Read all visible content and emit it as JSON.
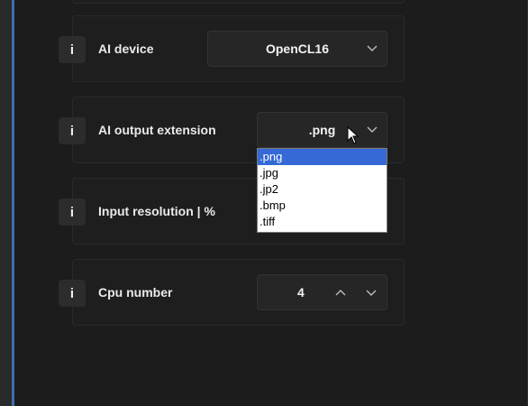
{
  "settings": [
    {
      "label": "AI device",
      "value": "OpenCL16",
      "info": "i"
    },
    {
      "label": "AI output extension",
      "value": ".png",
      "info": "i"
    },
    {
      "label": "Input resolution | %",
      "info": "i"
    },
    {
      "label": "Cpu number",
      "value": "4",
      "info": "i"
    }
  ],
  "dropdown": {
    "options": [
      ".png",
      ".jpg",
      ".jp2",
      ".bmp",
      ".tiff"
    ],
    "selected_index": 0
  },
  "colors": {
    "background": "#1c1c1c",
    "card": "#1e1e1e",
    "selection": "#3469d6",
    "accent_edge": "#3d6fae"
  },
  "icons": {
    "info": "info-icon",
    "chevron": "chevron-down-icon",
    "increment": "chevron-up-icon",
    "cursor": "mouse-cursor-icon"
  }
}
